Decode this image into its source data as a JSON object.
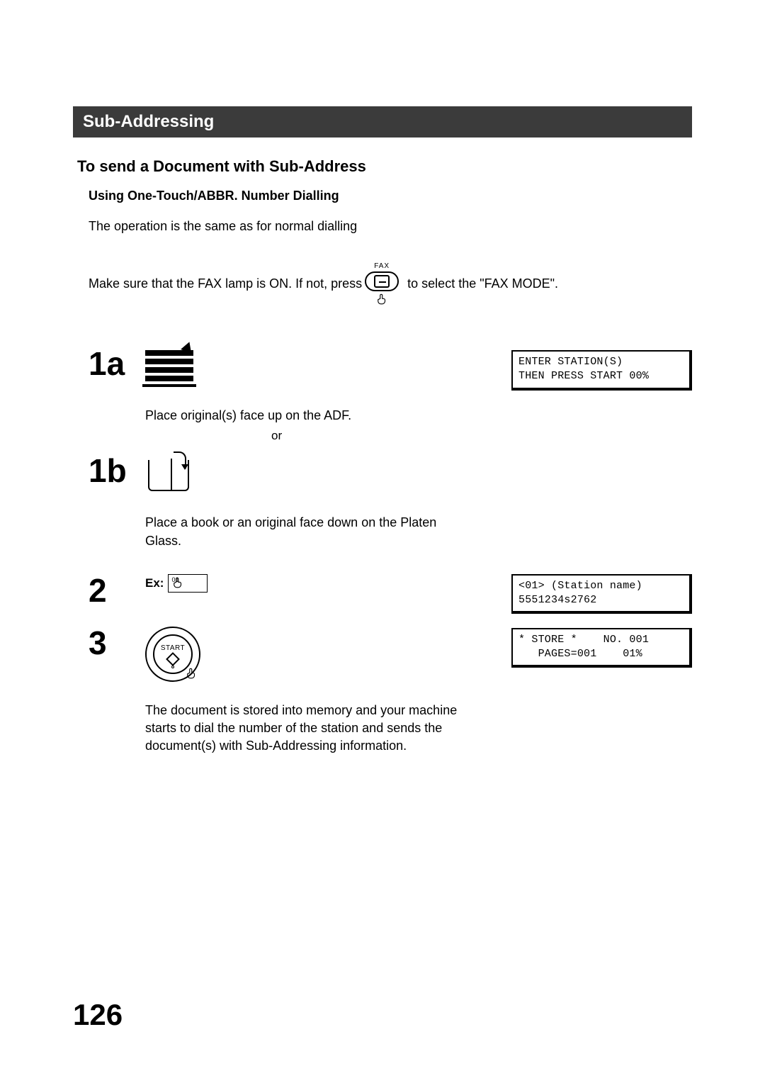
{
  "section_title": "Sub-Addressing",
  "heading": "To send a Document with Sub-Address",
  "subheading": "Using One-Touch/ABBR. Number Dialling",
  "intro": "The operation is the same as for normal dialling",
  "make_sure_left": "Make sure that the FAX lamp is ON.  If not, press ",
  "make_sure_right": " to select the \"FAX MODE\".",
  "fax_icon_label": "FAX",
  "steps": {
    "s1a": {
      "num": "1a",
      "caption": "Place original(s) face up on the ADF.",
      "lcd": "ENTER STATION(S)\nTHEN PRESS START 00%"
    },
    "or": "or",
    "s1b": {
      "num": "1b",
      "caption": "Place a book or an original face down on the Platen Glass."
    },
    "s2": {
      "num": "2",
      "ex_label": "Ex:",
      "key_label": "01",
      "lcd": "<01> (Station name)\n5551234s2762"
    },
    "s3": {
      "num": "3",
      "start_label": "START",
      "caption": "The document is stored into memory and your machine starts to dial the number of the station and sends the document(s) with Sub-Addressing information.",
      "lcd": "* STORE *    NO. 001\n   PAGES=001    01%"
    }
  },
  "page_number": "126"
}
